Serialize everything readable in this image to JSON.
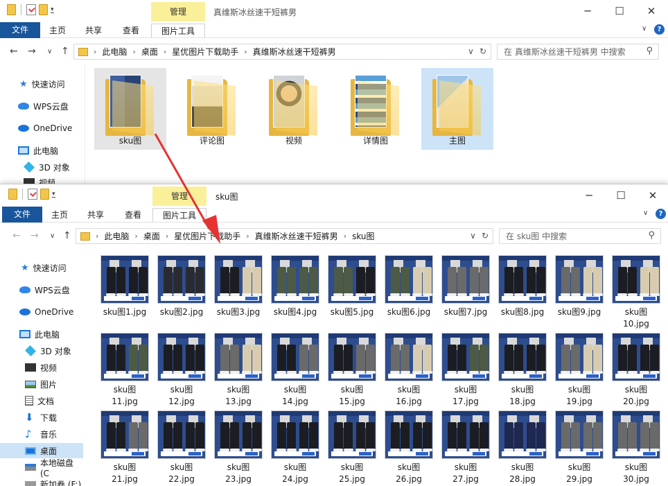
{
  "colors": {
    "accent": "#1e66c2",
    "file_tab": "#19559a",
    "context_tab": "#faf09a",
    "selection": "#cce3f8",
    "arrow": "#e53232"
  },
  "window_top": {
    "context_tab": "管理",
    "title": "真维斯冰丝速干短裤男",
    "ribbon_tabs": [
      "文件",
      "主页",
      "共享",
      "查看",
      "图片工具"
    ],
    "breadcrumb": [
      "此电脑",
      "桌面",
      "星优图片下载助手",
      "真维斯冰丝速干短裤男"
    ],
    "search_placeholder": "在 真维斯冰丝速干短裤男 中搜索",
    "sidebar": [
      "快速访问",
      "WPS云盘",
      "OneDrive",
      "此电脑",
      "3D 对象",
      "视频"
    ],
    "folders": [
      {
        "name": "sku图",
        "state": "hover"
      },
      {
        "name": "评论图",
        "state": "normal"
      },
      {
        "name": "视频",
        "state": "normal"
      },
      {
        "name": "详情图",
        "state": "normal"
      },
      {
        "name": "主图",
        "state": "selected"
      }
    ]
  },
  "window_bottom": {
    "context_tab": "管理",
    "title": "sku图",
    "ribbon_tabs": [
      "文件",
      "主页",
      "共享",
      "查看",
      "图片工具"
    ],
    "breadcrumb": [
      "此电脑",
      "桌面",
      "星优图片下载助手",
      "真维斯冰丝速干短裤男",
      "sku图"
    ],
    "search_placeholder": "在 sku图 中搜索",
    "sidebar": [
      "快速访问",
      "WPS云盘",
      "OneDrive",
      "此电脑",
      "3D 对象",
      "视频",
      "图片",
      "文档",
      "下载",
      "音乐",
      "桌面",
      "本地磁盘 (C",
      "新加卷 (F:)"
    ],
    "active_sidebar": "桌面",
    "files": [
      {
        "l1": "sku图1.jpg",
        "l2": "",
        "c1": "#1c1d22",
        "c2": "#1c1d22"
      },
      {
        "l1": "sku图2.jpg",
        "l2": "",
        "c1": "#2a2b30",
        "c2": "#2a2b30"
      },
      {
        "l1": "sku图3.jpg",
        "l2": "",
        "c1": "#1c1d22",
        "c2": "#d8ccb0"
      },
      {
        "l1": "sku图4.jpg",
        "l2": "",
        "c1": "#4d5a45",
        "c2": "#4d5a45"
      },
      {
        "l1": "sku图5.jpg",
        "l2": "",
        "c1": "#4d5a45",
        "c2": "#1c1d22"
      },
      {
        "l1": "sku图6.jpg",
        "l2": "",
        "c1": "#4d5a45",
        "c2": "#d8ccb0"
      },
      {
        "l1": "sku图7.jpg",
        "l2": "",
        "c1": "#6a6a6a",
        "c2": "#6a6a6a"
      },
      {
        "l1": "sku图8.jpg",
        "l2": "",
        "c1": "#1c1d22",
        "c2": "#1c1d22"
      },
      {
        "l1": "sku图9.jpg",
        "l2": "",
        "c1": "#6a6a6a",
        "c2": "#d8ccb0"
      },
      {
        "l1": "sku图",
        "l2": "10.jpg",
        "c1": "#1c1d22",
        "c2": "#d8ccb0"
      },
      {
        "l1": "sku图",
        "l2": "11.jpg",
        "c1": "#1c1d22",
        "c2": "#4d5a45"
      },
      {
        "l1": "sku图",
        "l2": "12.jpg",
        "c1": "#1c1d22",
        "c2": "#1c1d22"
      },
      {
        "l1": "sku图",
        "l2": "13.jpg",
        "c1": "#6a6a6a",
        "c2": "#d8ccb0"
      },
      {
        "l1": "sku图",
        "l2": "14.jpg",
        "c1": "#1c1d22",
        "c2": "#6a6a6a"
      },
      {
        "l1": "sku图",
        "l2": "15.jpg",
        "c1": "#1c1d22",
        "c2": "#6a6a6a"
      },
      {
        "l1": "sku图",
        "l2": "16.jpg",
        "c1": "#6a6a6a",
        "c2": "#d8ccb0"
      },
      {
        "l1": "sku图",
        "l2": "17.jpg",
        "c1": "#1c1d22",
        "c2": "#4d5a45"
      },
      {
        "l1": "sku图",
        "l2": "18.jpg",
        "c1": "#1c1d22",
        "c2": "#1c1d22"
      },
      {
        "l1": "sku图",
        "l2": "19.jpg",
        "c1": "#6a6a6a",
        "c2": "#d8ccb0"
      },
      {
        "l1": "sku图",
        "l2": "20.jpg",
        "c1": "#1c1d22",
        "c2": "#1c1d22"
      },
      {
        "l1": "sku图",
        "l2": "21.jpg",
        "c1": "#1c1d22",
        "c2": "#6a6a6a"
      },
      {
        "l1": "sku图",
        "l2": "22.jpg",
        "c1": "#1c1d22",
        "c2": "#1c1d22"
      },
      {
        "l1": "sku图",
        "l2": "23.jpg",
        "c1": "#1c1d22",
        "c2": "#1c1d22"
      },
      {
        "l1": "sku图",
        "l2": "24.jpg",
        "c1": "#1c1d22",
        "c2": "#1c1d22"
      },
      {
        "l1": "sku图",
        "l2": "25.jpg",
        "c1": "#1c1d22",
        "c2": "#1c1d22"
      },
      {
        "l1": "sku图",
        "l2": "26.jpg",
        "c1": "#1c1d22",
        "c2": "#1c1d22"
      },
      {
        "l1": "sku图",
        "l2": "27.jpg",
        "c1": "#1c1d22",
        "c2": "#1c1d22"
      },
      {
        "l1": "sku图",
        "l2": "28.jpg",
        "c1": "#1f2850",
        "c2": "#1f2850"
      },
      {
        "l1": "sku图",
        "l2": "29.jpg",
        "c1": "#6a6a6a",
        "c2": "#6a6a6a"
      },
      {
        "l1": "sku图",
        "l2": "30.jpg",
        "c1": "#6a6a6a",
        "c2": "#6a6a6a"
      }
    ]
  }
}
